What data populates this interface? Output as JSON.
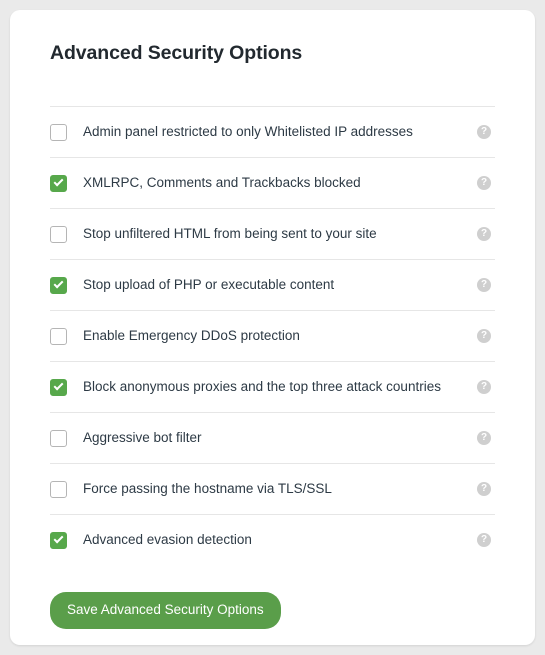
{
  "card": {
    "title": "Advanced Security Options"
  },
  "options": [
    {
      "label": "Admin panel restricted to only Whitelisted IP addresses",
      "checked": false,
      "help": "?"
    },
    {
      "label": "XMLRPC, Comments and Trackbacks blocked",
      "checked": true,
      "help": "?"
    },
    {
      "label": "Stop unfiltered HTML from being sent to your site",
      "checked": false,
      "help": "?"
    },
    {
      "label": "Stop upload of PHP or executable content",
      "checked": true,
      "help": "?"
    },
    {
      "label": "Enable Emergency DDoS protection",
      "checked": false,
      "help": "?"
    },
    {
      "label": "Block anonymous proxies and the top three attack countries",
      "checked": true,
      "help": "?"
    },
    {
      "label": "Aggressive bot filter",
      "checked": false,
      "help": "?"
    },
    {
      "label": "Force passing the hostname via TLS/SSL",
      "checked": false,
      "help": "?"
    },
    {
      "label": "Advanced evasion detection",
      "checked": true,
      "help": "?"
    }
  ],
  "save": {
    "label": "Save Advanced Security Options"
  },
  "colors": {
    "accent_green": "#57a84b",
    "button_green": "#5a9e4a",
    "title_text": "#22292f",
    "label_text": "#2d3a45",
    "divider": "#e6e6e6",
    "page_background": "#eaeaea",
    "card_background": "#ffffff",
    "help_icon": "#cfcfcf"
  }
}
